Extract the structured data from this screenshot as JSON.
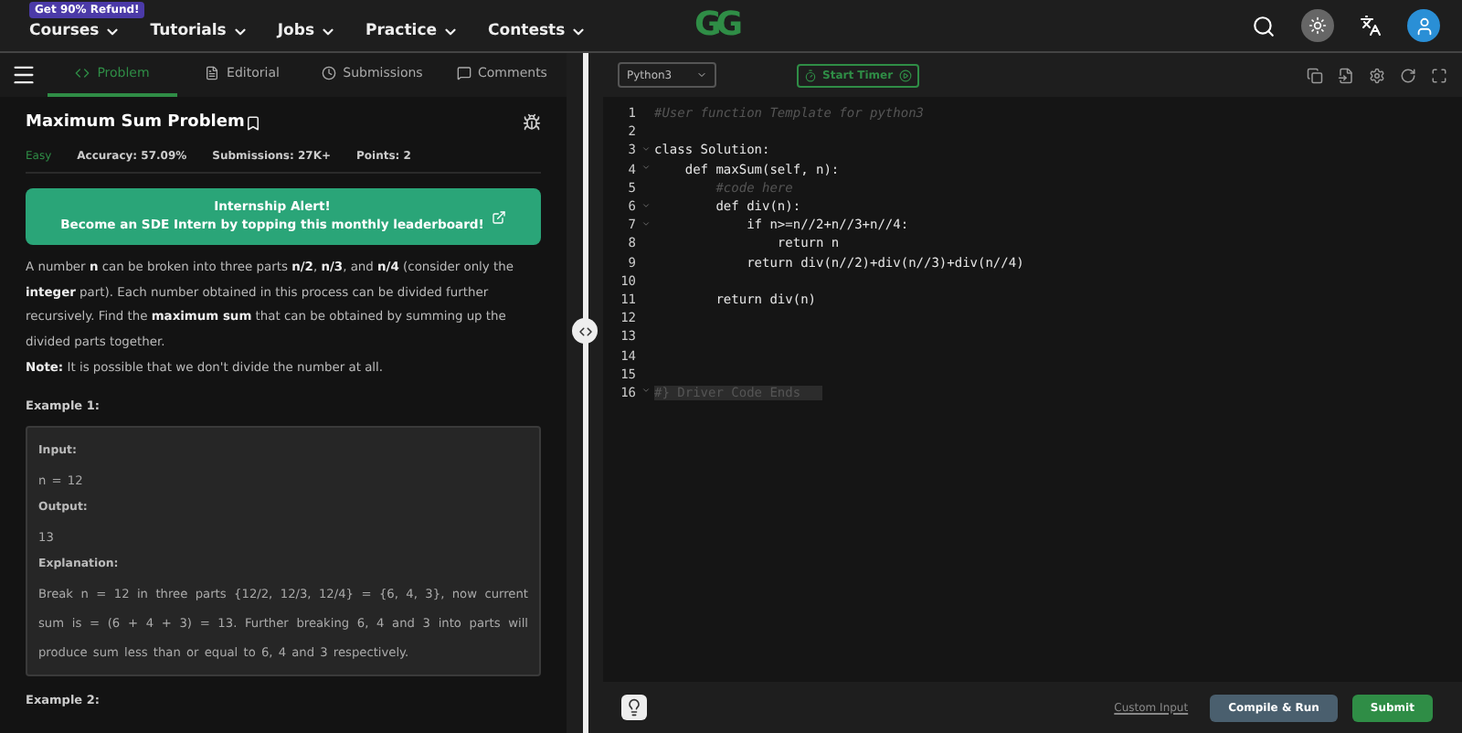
{
  "nav": {
    "promo_badge": "Get 90% Refund!",
    "menu": [
      {
        "label": "Courses"
      },
      {
        "label": "Tutorials"
      },
      {
        "label": "Jobs"
      },
      {
        "label": "Practice"
      },
      {
        "label": "Contests"
      }
    ],
    "logo": "GG"
  },
  "tabs": [
    {
      "label": "Problem",
      "selected": true
    },
    {
      "label": "Editorial",
      "selected": false
    },
    {
      "label": "Submissions",
      "selected": false
    },
    {
      "label": "Comments",
      "selected": false
    }
  ],
  "problem": {
    "title": "Maximum Sum Problem",
    "difficulty": "Easy",
    "accuracy": "Accuracy: 57.09%",
    "submissions": "Submissions: 27K+",
    "points": "Points: 2",
    "banner": [
      "Internship Alert!",
      "Become an SDE Intern by topping this monthly leaderboard!"
    ],
    "description": "A number **n** can be broken into three parts **n/2**, **n/3**, and **n/4** (consider only the **integer** part). Each number obtained in this process can be divided further recursively. Find the **maximum sum** that can be obtained by summing up the divided parts together.",
    "note": "**Note:** It is possible that we don't divide the number at all.",
    "examples": [
      {
        "heading": "Example 1:",
        "lines": [
          {
            "kind": "label",
            "text": "Input:"
          },
          {
            "kind": "value",
            "text": "n = 12"
          },
          {
            "kind": "label",
            "text": "Output:"
          },
          {
            "kind": "value",
            "text": "13"
          },
          {
            "kind": "label",
            "text": "Explanation:"
          },
          {
            "kind": "value",
            "text": "Break n = 12 in three parts {12/2, 12/3, 12/4} = {6, 4, 3}, now current sum is = (6 + 4 + 3) = 13. Further breaking 6, 4 and 3 into parts will produce sum less than or equal to 6, 4 and 3 respectively."
          }
        ]
      },
      {
        "heading": "Example 2:"
      }
    ]
  },
  "editor": {
    "language": "Python3",
    "timer": "Start Timer",
    "lines": [
      {
        "number": "1",
        "kind": "comment",
        "text": "#User function Template for python3",
        "foldable": false
      },
      {
        "number": "2",
        "foldable": false
      },
      {
        "number": "3",
        "kind": "code",
        "text": "class Solution:",
        "foldable": true
      },
      {
        "number": "4",
        "kind": "code",
        "text": "    def maxSum(self, n):",
        "foldable": true
      },
      {
        "number": "5",
        "kind": "comment",
        "text": "        #code here",
        "foldable": false
      },
      {
        "number": "6",
        "kind": "code",
        "text": "        def div(n):",
        "foldable": true
      },
      {
        "number": "7",
        "kind": "code",
        "text": "            if n>=n//2+n//3+n//4:",
        "foldable": true
      },
      {
        "number": "8",
        "kind": "code",
        "text": "                return n",
        "foldable": false
      },
      {
        "number": "9",
        "kind": "code",
        "text": "            return div(n//2)+div(n//3)+div(n//4)",
        "foldable": false
      },
      {
        "number": "10",
        "foldable": false
      },
      {
        "number": "11",
        "kind": "code",
        "text": "        return div(n)",
        "foldable": false
      },
      {
        "number": "12",
        "foldable": false
      },
      {
        "number": "13",
        "foldable": false
      },
      {
        "number": "14",
        "foldable": false
      },
      {
        "number": "15",
        "foldable": false
      },
      {
        "number": "16",
        "kind": "folded",
        "text": "#} Driver Code Ends",
        "foldable": true
      }
    ]
  },
  "footer": {
    "custom_input": "Custom Input",
    "compile": "Compile & Run",
    "submit": "Submit"
  }
}
